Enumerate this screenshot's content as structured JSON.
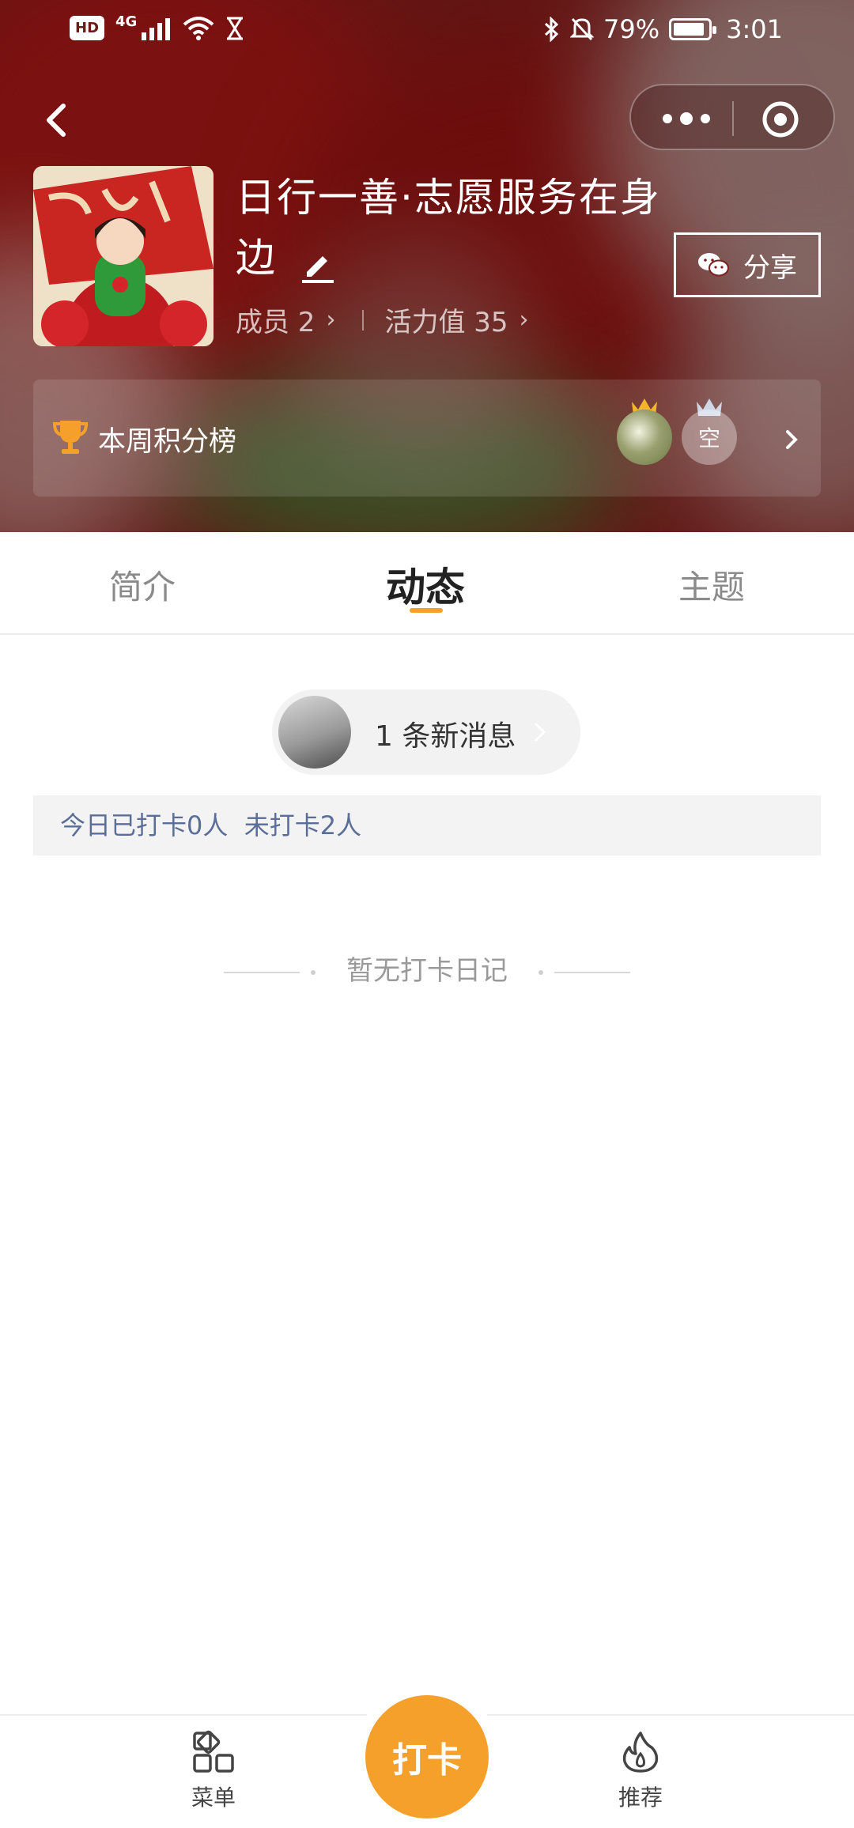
{
  "status_bar": {
    "network": "4G",
    "hd": "HD",
    "battery": "79%",
    "battery_level": 0.79,
    "time": "3:01"
  },
  "group": {
    "title": "日行一善·志愿服务在身边",
    "members_label": "成员 2",
    "vitality_label": "活力值 35",
    "share_label": "分享"
  },
  "leaderboard": {
    "label": "本周积分榜",
    "empty_avatar_text": "空"
  },
  "tabs": [
    "简介",
    "动态",
    "主题"
  ],
  "active_tab": "动态",
  "feed": {
    "new_messages": "1 条新消息",
    "checkin_status": "今日已打卡0人  未打卡2人",
    "empty_text": "暂无打卡日记"
  },
  "bottom_nav": {
    "menu": "菜单",
    "checkin": "打卡",
    "recommend": "推荐"
  },
  "colors": {
    "accent": "#f5a02a",
    "checkin_text": "#5b6e98",
    "header_bg": "#6e1a18"
  },
  "icons": [
    "back-icon",
    "more-icon",
    "target-icon",
    "edit-icon",
    "wechat-icon",
    "trophy-icon",
    "crown-icon",
    "chevron-right-icon",
    "grid-menu-icon",
    "flame-icon"
  ]
}
